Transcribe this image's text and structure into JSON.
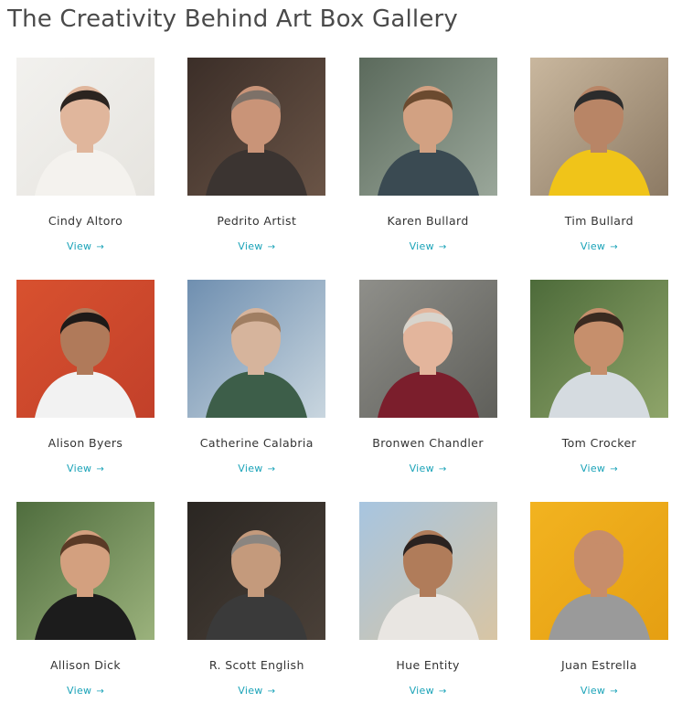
{
  "page": {
    "title": "The Creativity Behind Art Box Gallery"
  },
  "artists": [
    {
      "name": "Cindy Altoro",
      "link": "View",
      "arrow": "→",
      "photo": {
        "bg": "#f2f1ee",
        "bg2": "#e6e4df",
        "skin": "#e0b69c",
        "hair": "#2b2420",
        "shirt": "#f4f2ee"
      }
    },
    {
      "name": "Pedrito Artist",
      "link": "View",
      "arrow": "→",
      "photo": {
        "bg": "#3b2e28",
        "bg2": "#6a5446",
        "skin": "#c99478",
        "hair": "#7d7168",
        "shirt": "#3b3431"
      }
    },
    {
      "name": "Karen Bullard",
      "link": "View",
      "arrow": "→",
      "photo": {
        "bg": "#5b6a5c",
        "bg2": "#9aa79a",
        "skin": "#d2a182",
        "hair": "#6b4a2f",
        "shirt": "#3a4a52"
      }
    },
    {
      "name": "Tim Bullard",
      "link": "View",
      "arrow": "→",
      "photo": {
        "bg": "#c9b79e",
        "bg2": "#8c7a64",
        "skin": "#b88566",
        "hair": "#2c2c2c",
        "shirt": "#f0c419"
      }
    },
    {
      "name": "Alison Byers",
      "link": "View",
      "arrow": "→",
      "photo": {
        "bg": "#d8512f",
        "bg2": "#c2402a",
        "skin": "#b07a5a",
        "hair": "#1e1a18",
        "shirt": "#f2f2f2"
      }
    },
    {
      "name": "Catherine Calabria",
      "link": "View",
      "arrow": "→",
      "photo": {
        "bg": "#6f8fb0",
        "bg2": "#c9d6df",
        "skin": "#d6b49c",
        "hair": "#a07e62",
        "shirt": "#3d5e49"
      }
    },
    {
      "name": "Bronwen Chandler",
      "link": "View",
      "arrow": "→",
      "photo": {
        "bg": "#8f8f8a",
        "bg2": "#5f5f5a",
        "skin": "#e3b59c",
        "hair": "#d8d4cc",
        "shirt": "#7b1e2c"
      }
    },
    {
      "name": "Tom Crocker",
      "link": "View",
      "arrow": "→",
      "photo": {
        "bg": "#4d6b3a",
        "bg2": "#8fa56a",
        "skin": "#c68f6c",
        "hair": "#3a2a20",
        "shirt": "#d5dbe0"
      }
    },
    {
      "name": "Allison Dick",
      "link": "View",
      "arrow": "→",
      "photo": {
        "bg": "#4f6d3e",
        "bg2": "#9bb27c",
        "skin": "#d3a07f",
        "hair": "#5a3a26",
        "shirt": "#1c1c1c"
      }
    },
    {
      "name": "R. Scott English",
      "link": "View",
      "arrow": "→",
      "photo": {
        "bg": "#2a2622",
        "bg2": "#4a4038",
        "skin": "#c49a7c",
        "hair": "#8a8580",
        "shirt": "#3a3a3a"
      }
    },
    {
      "name": "Hue Entity",
      "link": "View",
      "arrow": "→",
      "photo": {
        "bg": "#a7c5e0",
        "bg2": "#d8c5a4",
        "skin": "#b07c5a",
        "hair": "#2a2220",
        "shirt": "#e9e6e2"
      }
    },
    {
      "name": "Juan Estrella",
      "link": "View",
      "arrow": "→",
      "photo": {
        "bg": "#f2b320",
        "bg2": "#e59f12",
        "skin": "#c78d6a",
        "hair": "#c78d6a",
        "shirt": "#9a9a9a"
      }
    }
  ],
  "colors": {
    "link": "#1aa3b8",
    "title": "#4a4a4a",
    "name": "#333333"
  }
}
